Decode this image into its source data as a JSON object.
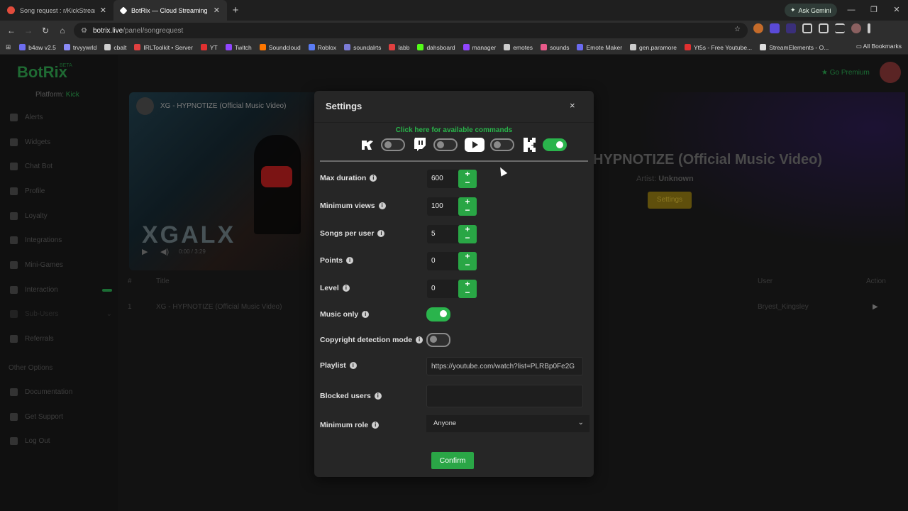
{
  "browser": {
    "tabs": [
      {
        "title": "Song request : r/KickStreaming",
        "active": false,
        "color": "#e24c3c"
      },
      {
        "title": "BotRix — Cloud Streaming Bot",
        "active": true,
        "color": "#ffffff"
      }
    ],
    "new_tab": "+",
    "ask_gemini": "Ask Gemini",
    "url_domain": "botrix.live",
    "url_path": "/panel/songrequest",
    "bookmarks": [
      {
        "label": "b4aw v2.5",
        "color": "#6d6df0"
      },
      {
        "label": "trvyywrld",
        "color": "#8a8af5"
      },
      {
        "label": "cbalt",
        "color": "#d0d0d0"
      },
      {
        "label": "IRLToolkit • Server",
        "color": "#e04040"
      },
      {
        "label": "YT",
        "color": "#e03030"
      },
      {
        "label": "Twitch",
        "color": "#9146ff"
      },
      {
        "label": "Soundcloud",
        "color": "#ff7700"
      },
      {
        "label": "Roblox",
        "color": "#5a7cf5"
      },
      {
        "label": "soundalrts",
        "color": "#7b7bd6"
      },
      {
        "label": "labb",
        "color": "#e04040"
      },
      {
        "label": "dahsboard",
        "color": "#53fc18"
      },
      {
        "label": "manager",
        "color": "#9146ff"
      },
      {
        "label": "emotes",
        "color": "#cccccc"
      },
      {
        "label": "sounds",
        "color": "#e85a8a"
      },
      {
        "label": "Emote Maker",
        "color": "#6a6af0"
      },
      {
        "label": "gen.paramore",
        "color": "#cccccc"
      },
      {
        "label": "Yt5s - Free Youtube...",
        "color": "#e03030"
      },
      {
        "label": "StreamElements - O...",
        "color": "#dddddd"
      }
    ],
    "all_bookmarks": "All Bookmarks"
  },
  "sidebar": {
    "logo": "BotRix",
    "beta": "BETA",
    "platform_label": "Platform:",
    "platform_value": "Kick",
    "items": [
      "Alerts",
      "Widgets",
      "Chat Bot",
      "Profile",
      "Loyalty",
      "Integrations",
      "Mini-Games",
      "Interaction",
      "Sub-Users",
      "Referrals"
    ],
    "other_options_title": "Other Options",
    "other_items": [
      "Documentation",
      "Get Support",
      "Log Out"
    ]
  },
  "header": {
    "premium": "Go Premium"
  },
  "player": {
    "video_title": "XG - HYPNOTIZE (Official Music Video)",
    "overlay_text": "XGALX",
    "time": "0:00 / 3:29"
  },
  "now_playing": {
    "title": "HYPNOTIZE (Official Music Video)",
    "artist_label": "Artist:",
    "artist_value": "Unknown",
    "settings_button": "Settings"
  },
  "queue": {
    "headers": {
      "num": "#",
      "title": "Title",
      "user": "User",
      "action": "Action"
    },
    "rows": [
      {
        "num": "1",
        "title": "XG - HYPNOTIZE (Official Music Video)",
        "user": "Bryest_Kingsley",
        "action": "▶"
      }
    ]
  },
  "modal": {
    "title": "Settings",
    "close": "×",
    "commands_link": "Click here for available commands",
    "platforms": [
      {
        "name": "kick-bot-icon",
        "enabled": false
      },
      {
        "name": "twitch-icon",
        "enabled": false
      },
      {
        "name": "youtube-icon",
        "enabled": false
      },
      {
        "name": "kick-icon",
        "enabled": true
      }
    ],
    "fields": {
      "max_duration": {
        "label": "Max duration",
        "value": "600"
      },
      "min_views": {
        "label": "Minimum views",
        "value": "100"
      },
      "songs_per_user": {
        "label": "Songs per user",
        "value": "5"
      },
      "points": {
        "label": "Points",
        "value": "0"
      },
      "level": {
        "label": "Level",
        "value": "0"
      },
      "music_only": {
        "label": "Music only",
        "enabled": true
      },
      "copyright": {
        "label": "Copyright detection mode",
        "enabled": false
      },
      "playlist": {
        "label": "Playlist",
        "value": "https://youtube.com/watch?list=PLRBp0Fe2G"
      },
      "blocked_users": {
        "label": "Blocked users",
        "value": ""
      },
      "min_role": {
        "label": "Minimum role",
        "value": "Anyone"
      }
    },
    "confirm": "Confirm",
    "stepper_plus": "+",
    "stepper_minus": "−",
    "info_glyph": "i"
  },
  "colors": {
    "accent": "#29a645",
    "link": "#29b34a",
    "modal_bg": "#262626"
  }
}
